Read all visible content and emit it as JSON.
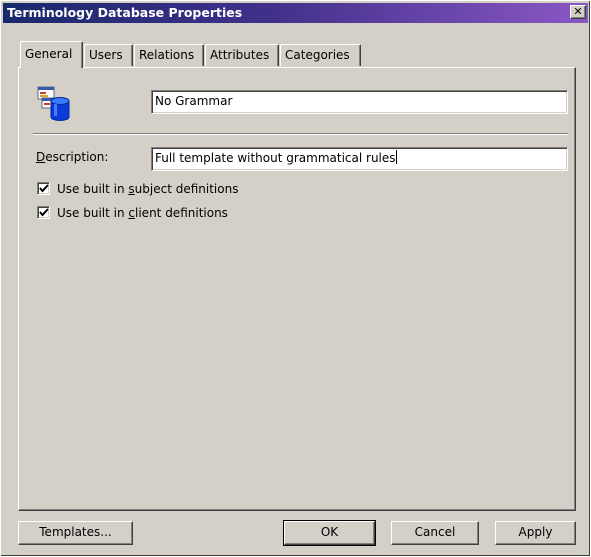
{
  "window": {
    "title": "Terminology Database Properties",
    "close_glyph": "✕"
  },
  "tabs": [
    {
      "label": "General",
      "active": true
    },
    {
      "label": "Users",
      "active": false
    },
    {
      "label": "Relations",
      "active": false
    },
    {
      "label": "Attributes",
      "active": false
    },
    {
      "label": "Categories",
      "active": false
    }
  ],
  "general": {
    "name_value": "No Grammar",
    "description": {
      "label_pre": "",
      "label_accel": "D",
      "label_post": "escription:",
      "value": "Full template without grammatical rules"
    },
    "checkboxes": [
      {
        "label_pre": "Use built in ",
        "label_accel": "s",
        "label_post": "ubject definitions",
        "checked": true
      },
      {
        "label_pre": "Use built in ",
        "label_accel": "c",
        "label_post": "lient definitions",
        "checked": true
      }
    ]
  },
  "buttons": {
    "templates": "Templates...",
    "ok": "OK",
    "cancel": "Cancel",
    "apply": "Apply"
  },
  "icons": {
    "database": "database-icon",
    "close": "close-icon",
    "check": "checkmark-icon"
  },
  "colors": {
    "titlebar_start": "#18296b",
    "titlebar_end": "#8a57c4",
    "face": "#d4d0c8"
  }
}
